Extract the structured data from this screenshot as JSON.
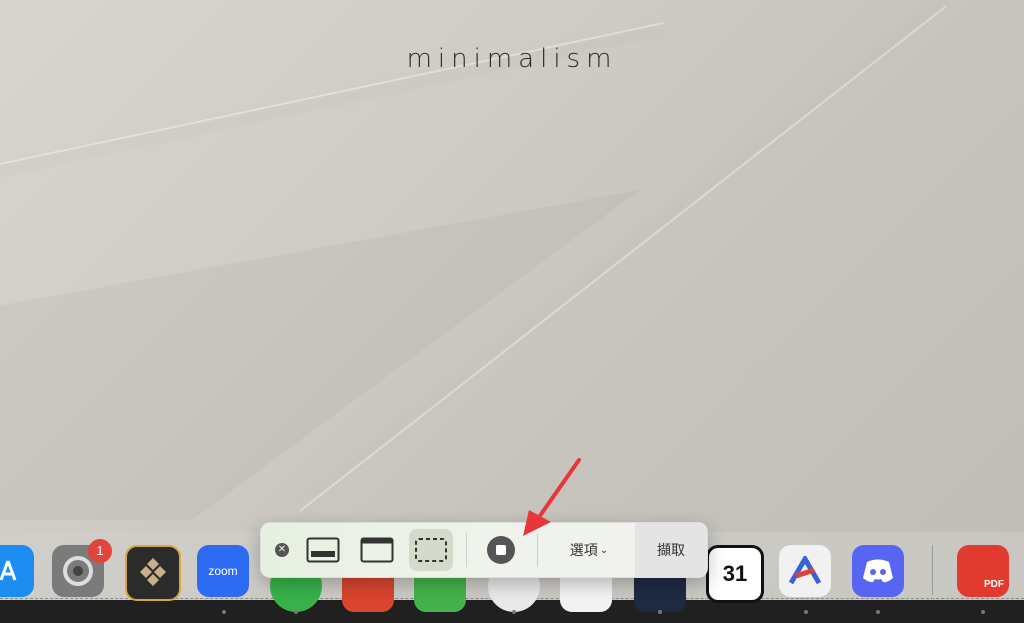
{
  "wallpaper": {
    "title": "minimalism"
  },
  "dock": {
    "badge_count": "1",
    "apps": [
      {
        "name": "app-store-icon",
        "label": "",
        "color": "#1d8cf0"
      },
      {
        "name": "system-settings-icon",
        "label": "",
        "color": "#7b7b7b"
      },
      {
        "name": "setapp-icon",
        "label": "",
        "color": "#2b2b2b"
      },
      {
        "name": "zoom-icon",
        "label": "zoom",
        "color": "#2d6cf2"
      },
      {
        "name": "messages-icon",
        "label": "",
        "color": "#38b24a"
      },
      {
        "name": "calendar-icon",
        "label": "31",
        "color": "#ffffff"
      },
      {
        "name": "discord-icon",
        "label": "",
        "color": "#5865f2"
      },
      {
        "name": "pdf-app-icon",
        "label": "PDF",
        "color": "#e13a2f"
      }
    ]
  },
  "toolbar": {
    "options_label": "選項",
    "capture_label": "擷取"
  },
  "colors": {
    "arrow": "#e8373a"
  }
}
